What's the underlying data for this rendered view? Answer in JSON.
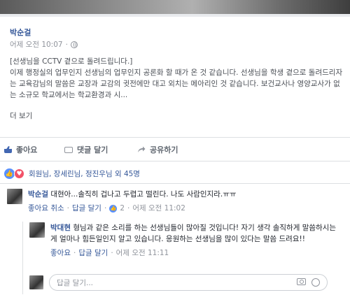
{
  "post": {
    "author": "박순걸",
    "time": "어제 오전 10:07",
    "body_lines": [
      "[선생님을 CCTV 곁으로 돌려드립니다.]",
      "이제 행정실의 업무인지 선생님의 업무인지 공론화 할 때가 온 것 같습니다. 선생님을 학생 곁으로 돌려드리자는 교육감님의 말씀은 교장과 교감의 귓전에만 대고 외치는 메아리인 것 같습니다. 보건교사나 영양교사가 없는 소규모 학교에서는 학교환경과 시..."
    ],
    "more_label": "더 보기"
  },
  "actions": {
    "like": "좋아요",
    "comment": "댓글 달기",
    "share": "공유하기"
  },
  "reactions": {
    "summary": "회원님, 장세린님, 정진우님 외 45명"
  },
  "comments": [
    {
      "name": "박순걸",
      "text": " 대현아...솔직히 겁나고 두렵고 떨린다. 나도 사람인지라.ㅠㅠ",
      "like_label": "좋아요 취소",
      "reply_label": "답글 달기",
      "like_count": "2",
      "time": "어제 오전 11:02"
    },
    {
      "name": "박대현",
      "text": " 형님과 같은 소리를 하는 선생님들이 많아질 것입니다! 자기 생각 솔직하게 말씀하시는게 얼마나 힘든일인지 알고 있습니다. 응원하는 선생님을 많이 있다는 말씀 드려요!!",
      "like_label": "좋아요",
      "reply_label": "답글 달기",
      "time": "어제 오전 11:11"
    }
  ],
  "reply": {
    "placeholder": "답글 달기..."
  },
  "colors": {
    "link": "#365899",
    "muted": "#90949c",
    "like_blue": "#5890ff",
    "heart_red": "#f25268"
  }
}
